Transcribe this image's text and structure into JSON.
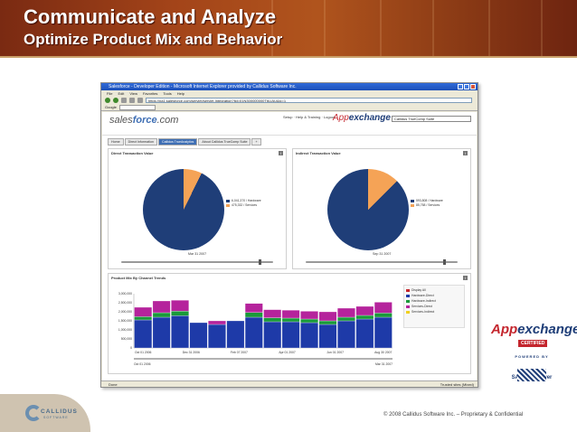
{
  "slide": {
    "title": "Communicate and Analyze",
    "subtitle": "Optimize Product Mix and Behavior",
    "copyright": "© 2008 Callidus Software Inc. – Proprietary & Confidential"
  },
  "browser": {
    "title": "Salesforce - Developer Edition - Microsoft Internet Explorer provided by Callidus Software Inc.",
    "menu": [
      "File",
      "Edit",
      "View",
      "Favorites",
      "Tools",
      "Help"
    ],
    "address": "https://na1.salesforce.com/servlet/servlet.Integration?lid=01N300000000TbLIAU&ic=1",
    "google_label": "Google",
    "status_left": "Done",
    "status_right": "Trusted sites (Mixed)"
  },
  "salesforce": {
    "logo_a": "sales",
    "logo_b": "force",
    "logo_c": ".com",
    "links": "Setup · Help & Training · Logout",
    "appex_a": "App",
    "appex_b": "exchange",
    "app_select": "Callidus TrueComp Suite",
    "tabs": [
      {
        "label": "Home",
        "active": false
      },
      {
        "label": "Direct Information",
        "active": false
      },
      {
        "label": "Callidus TrueAnalytics",
        "active": true
      },
      {
        "label": "About Callidus TrueComp Suite",
        "active": false
      },
      {
        "label": "+",
        "active": false
      }
    ]
  },
  "direct": {
    "title": "Direct Transaction Value",
    "legend": [
      "6,041,370 / Hardware",
      "475,332 / Services"
    ],
    "values": [
      6041370,
      475332
    ],
    "date": "Mar 31 2007"
  },
  "indirect": {
    "title": "Indirect Transaction Value",
    "legend": [
      "593,808 / Hardware",
      "85,758 / Services"
    ],
    "values": [
      593808,
      85758
    ],
    "date": "Sep 31 2007"
  },
  "colors": {
    "navy": "#1f3e78",
    "orange": "#f5a356",
    "magenta": "#b5239c",
    "green": "#1a9a3a",
    "blue": "#1e3aa8"
  },
  "trend": {
    "title": "Product Mix By Channel Trends",
    "axis_start": "Oct 01 2006",
    "axis_end": "Mar 31 2007"
  },
  "chart_data": {
    "type": "bar",
    "stacked": true,
    "categories": [
      "Oct 01 2006",
      "",
      "Dec 31 2006",
      "",
      "Feb 07 2007",
      "",
      "",
      "Apr 01 2007",
      "",
      "Jun 01 2007",
      "",
      "",
      "Aug 30 2007",
      ""
    ],
    "x_tick_labels": [
      "Oct 01 2006",
      "Dec 31 2006",
      "Feb 07 2007",
      "Apr 01 2007",
      "Jun 01 2007",
      "Aug 30 2007"
    ],
    "ylim": [
      0,
      3000000
    ],
    "yticks": [
      "0",
      "500,000",
      "1,000,000",
      "1,500,000",
      "2,000,000",
      "2,500,000",
      "3,000,000"
    ],
    "series": [
      {
        "name": "Hardware-Direct",
        "color": "#1e3aa8",
        "values": [
          1550000,
          1700000,
          1780000,
          1400000,
          1300000,
          1500000,
          1700000,
          1450000,
          1450000,
          1400000,
          1300000,
          1500000,
          1600000,
          1700000
        ]
      },
      {
        "name": "Hardware-Indirect",
        "color": "#1a9a3a",
        "values": [
          180000,
          250000,
          260000,
          0,
          0,
          0,
          260000,
          220000,
          200000,
          200000,
          200000,
          200000,
          200000,
          230000
        ]
      },
      {
        "name": "Services-Direct",
        "color": "#b5239c",
        "values": [
          520000,
          650000,
          600000,
          0,
          200000,
          0,
          500000,
          450000,
          440000,
          430000,
          500000,
          500000,
          500000,
          600000
        ]
      }
    ],
    "legend_title": "Display All",
    "legend_items": [
      "Hardware-Direct",
      "Hardware-Indirect",
      "Services-Direct",
      "Services-Indirect"
    ],
    "legend_colors": [
      "#c4262e",
      "#1e3aa8",
      "#1a9a3a",
      "#b5239c",
      "#f0d020"
    ],
    "legend_labels": [
      "Display All",
      "Hardware-Direct",
      "Hardware-Indirect",
      "Services-Direct",
      "Services-Indirect"
    ]
  },
  "logos": {
    "appex_a": "App",
    "appex_b": "exchange",
    "certified": "CERTIFIED",
    "powered": "POWERED BY",
    "sap": "SAP NetWeaver",
    "callidus": "CALLIDUS",
    "software": "SOFTWARE"
  }
}
